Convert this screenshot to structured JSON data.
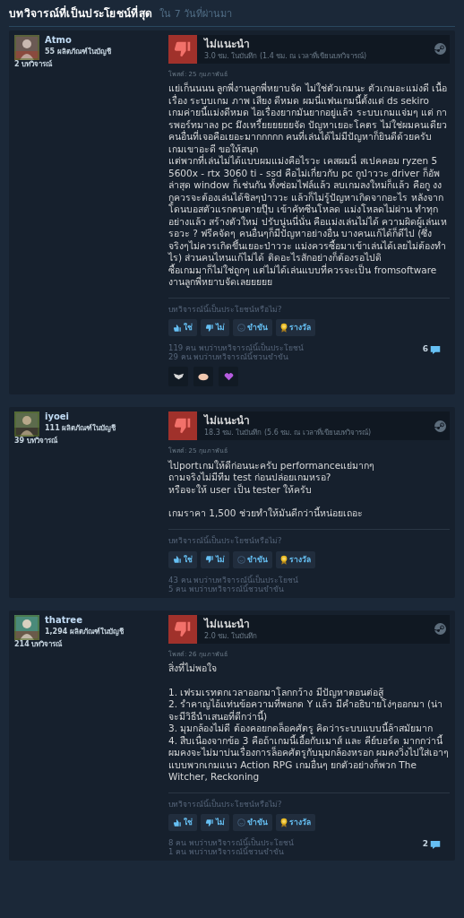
{
  "section_title": "บทวิจารณ์ที่เป็นประโยชน์ที่สุด",
  "section_subtitle": "ใน 7 วันที่ผ่านมา",
  "reviews": [
    {
      "author": "Atmo",
      "products": "55 ผลิตภัณฑ์ในบัญชี",
      "reviews_count": "2 บทวิจารณ์",
      "verdict": "ไม่แนะนำ",
      "recommended": false,
      "hours": "3.0 ชม. ในบันทึก (1.4 ชม. ณ เวลาที่เขียนบทวิจารณ์)",
      "posted": "โพสต์: 25 กุมภาพันธ์",
      "body": [
        [
          "แย่เก็นนนน ลูกพี่งานลูกพี่หยาบจัด ไม่ใช่ตัวเกมนะ ตัวเกมอะแม่งดี เนื้อเรื่อง ระบบเกม ภาพ เสียง ดีหมด ผมนี่แฟนเกมนี้ตั้งแต่ ds sekiro",
          "เกมค่ายนี้แม่งดีหมด ไอเรื่องยากมันยากอยู่แล้ว ระบบเกมแจ่มๆ แต่ การพอร์ทมาลง pc มึงเหรี้ยยยยยยจัด ปัญหาเยอะโคตร ไม่ใช่ผมคนเดียว คนอื่นที่เจอคือเยอะมากกกกก คนที่เล่นได้ไม่มีปัญหาก็ยินดีด้วยครับ เกมเขาอะดี ขอให้สนุก",
          "แต่พวกที่เล่นไม่ได้แบบผมแม่งคือไรวะ เคสผมนี่ สเปคคอม ryzen 5 5600x - rtx 3060 ti - ssd คือไม่เกี่ยวกับ pc กูป่าววะ driver ก็อัพล่าสุด window ก็เช่นกัน ทั้งซ่อมไฟล์แล้ว ลบเกมลงใหม่ก็แล้ว คือกู งง กูควรจะต้องเล่นได้ชิลๆป่าววะ แล้วก็ไม่รู้ปัญหาเกิดจากอะไร หลังจากโดนบอสตัวแรกตบตายปุ๊บ เข้าคัทซีนโหลด แม่งโหลดไม่ผ่าน ทำทุกอย่างแล้ว สร้างตัวใหม่ ปรับนู่นนี่นั่น คือแม่งเล่นไม่ได้ ความผิดผู้เล่นเหรอวะ ? ฟรีคจัดๆ คนอื่นๆก็มีปัญหาอย่างอื่น บางคนแก้ได้ก็ดีไป (ซึ่งจริงๆไม่ควรเกิดขึ้นเยอะป่าววะ แม่งควรซื้อมาเข้าเล่นได้เลยไม่ต้องทำไร) ส่วนคนไหนแก้ไม่ได้ ติดอะไรสักอย่างก็ต้องรอไปดิ",
          "ซื้อเกมมาก็ไม่ใช่ถูกๆ แต่ไม่ได้เล่นแบบที่ควรจะเป็น fromsoftware งานลูกพี่หยาบจัดเลยยยยย"
        ]
      ],
      "helpful_prompt": "บทวิจารณ์นี้เป็นประโยชน์หรือไม่?",
      "buttons": [
        {
          "kind": "yes",
          "label": "ใช่"
        },
        {
          "kind": "no",
          "label": "ไม่"
        },
        {
          "kind": "funny",
          "label": "ขำขัน"
        },
        {
          "kind": "award",
          "label": "รางวัล"
        }
      ],
      "helpful_count": "119 คน พบว่าบทวิจารณ์นี้เป็นประโยชน์",
      "funny_count": "29 คน พบว่าบทวิจารณ์นี้ชวนขำขัน",
      "comments": "6",
      "awards": [
        {
          "kind": "wings"
        },
        {
          "kind": "brain"
        },
        {
          "kind": "heart"
        }
      ]
    },
    {
      "author": "iyoei",
      "products": "111 ผลิตภัณฑ์ในบัญชี",
      "reviews_count": "39 บทวิจารณ์",
      "verdict": "ไม่แนะนำ",
      "recommended": false,
      "hours": "18.3 ชม. ในบันทึก (5.6 ชม. ณ เวลาที่เขียนบทวิจารณ์)",
      "posted": "โพสต์: 25 กุมภาพันธ์",
      "body": [
        [
          "ไปportเกมให้ดีก่อนนะครับ performanceแย่มากๆ",
          "ถามจริงไม่มีทีม test ก่อนปล่อยเกมหรอ?",
          "หรือจะให้ user เป็น tester ให้ครับ"
        ],
        [
          "เกมราคา 1,500 ช่วยทำให้มันดีกว่านี้หน่อยเถอะ"
        ]
      ],
      "helpful_prompt": "บทวิจารณ์นี้เป็นประโยชน์หรือไม่?",
      "buttons": [
        {
          "kind": "yes",
          "label": "ใช่"
        },
        {
          "kind": "no",
          "label": "ไม่"
        },
        {
          "kind": "funny",
          "label": "ขำขัน"
        },
        {
          "kind": "award",
          "label": "รางวัล"
        }
      ],
      "helpful_count": "43 คน พบว่าบทวิจารณ์นี้เป็นประโยชน์",
      "funny_count": "5 คน พบว่าบทวิจารณ์นี้ชวนขำขัน"
    },
    {
      "author": "thatree",
      "products": "1,294 ผลิตภัณฑ์ในบัญชี",
      "reviews_count": "214 บทวิจารณ์",
      "verdict": "ไม่แนะนำ",
      "recommended": false,
      "hours": "2.0 ชม. ในบันทึก",
      "posted": "โพสต์: 26 กุมภาพันธ์",
      "body": [
        [
          "สิ่งที่ไม่พอใจ"
        ],
        [
          "1. เฟรมเรทตกเวลาออกมาโลกกว้าง มีปัญหาตอนต่อสู้",
          "2. รำคาญไอ้แท่นข้อความที่พอกด Y แล้ว มีคำอธิบายโง่ๆออกมา (น่าจะมีวิธีนำเสนอที่ดีกว่านี้)",
          "3. มุมกล้องไม่ดี ต้องคอยกดล็อคศัตรู คิดว่าระบบแบบนี้ล้าสมัยมาก",
          "4. สืบเนื่องจากข้อ 3 คือถ้าเกมนี้เอื้อกับเมาส์ และ คีย์บอร์ด มากกว่านี้ ผมคงจะไม่มาบ่นเรื่องการล็อคศัตรูกับมุมกล้องหรอก ผมคงวิ่งไปใส่เอาๆแบบพวกเกมแนว Action RPG เกมอื่นๆ ยกตัวอย่างก็พวก The Witcher, Reckoning"
        ]
      ],
      "helpful_prompt": "บทวิจารณ์นี้เป็นประโยชน์หรือไม่?",
      "buttons": [
        {
          "kind": "yes",
          "label": "ใช่"
        },
        {
          "kind": "no",
          "label": "ไม่"
        },
        {
          "kind": "funny",
          "label": "ขำขัน"
        },
        {
          "kind": "award",
          "label": "รางวัล"
        }
      ],
      "helpful_count": "8 คน พบว่าบทวิจารณ์นี้เป็นประโยชน์",
      "funny_count": "1 คน พบว่าบทวิจารณ์นี้ชวนขำขัน",
      "comments": "2"
    }
  ]
}
